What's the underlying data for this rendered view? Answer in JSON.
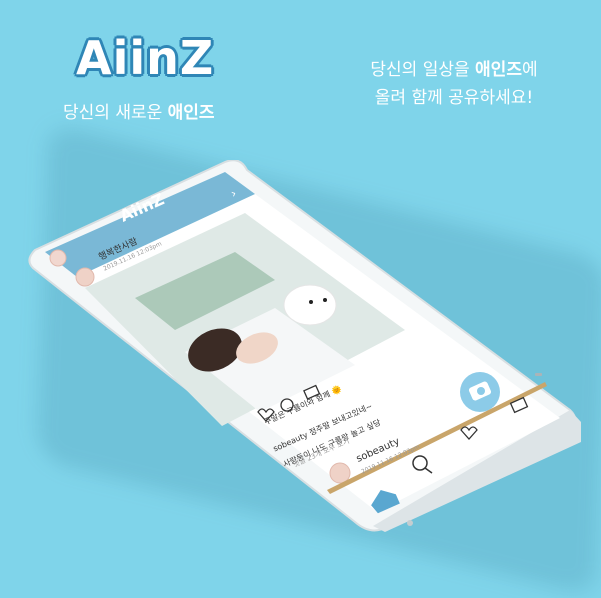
{
  "logo": {
    "text": "AiinZ"
  },
  "tagline_left": {
    "prefix": "당신의 새로운 ",
    "brand": "애인즈"
  },
  "tagline_right": {
    "line1_prefix": "당신의 일상을 ",
    "line1_brand": "애인즈",
    "line1_suffix": "에",
    "line2": "올려 함께 공유하세요!"
  },
  "app": {
    "header_logo": "AiinZ",
    "top_user": {
      "name": "행복한사람",
      "date": "2019.11.16 12:03pm"
    },
    "post": {
      "caption_line1": "주말은 구름이와 함께 🌞",
      "reply_user": "sobeauty",
      "reply_line1": "sobeauty 정주말 보내고있네~",
      "reply_line2": "사랑둥이 나도 구름랑 놀고 싶당",
      "more_comments": "댓글 23개 모두 보기"
    },
    "bottom_user": {
      "name": "sobeauty",
      "date": "2019.11.16 12:03pm"
    }
  },
  "colors": {
    "background": "#7fd4ea",
    "header_blue": "#7ab8d6",
    "accent_gold": "#c9a56a",
    "camera_button": "#8ccbe8"
  }
}
